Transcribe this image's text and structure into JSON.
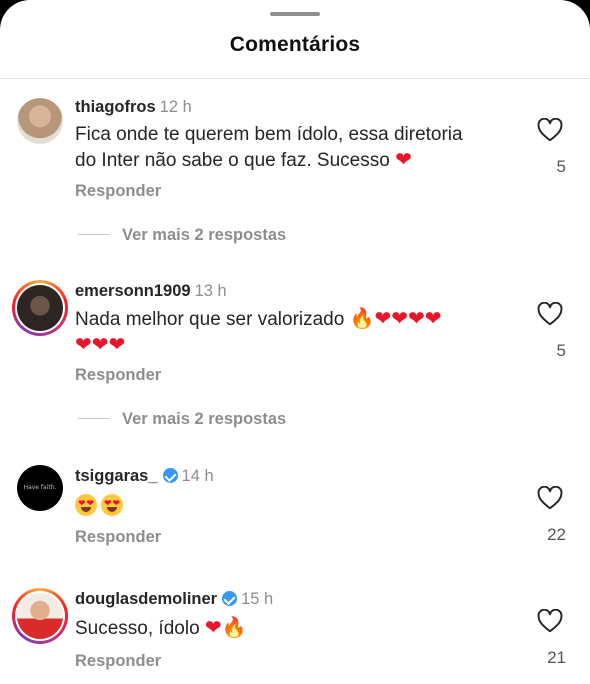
{
  "sheet": {
    "title": "Comentários"
  },
  "comments": [
    {
      "username": "thiagofros",
      "time": "12 h",
      "verified": false,
      "text_line1": "Fica onde te querem bem ídolo, essa diretoria",
      "text_line2": "do Inter não sabe o que faz. Sucesso ",
      "emojis_line2": [
        "heart"
      ],
      "reply_label": "Responder",
      "likes": "5",
      "view_more": "Ver mais 2 respostas"
    },
    {
      "username": "emersonn1909",
      "time": "13 h",
      "verified": false,
      "text_line1": "Nada melhor que ser valorizado ",
      "emojis_line1": [
        "fire",
        "heart",
        "heart",
        "heart",
        "heart"
      ],
      "emojis_line2": [
        "heart",
        "heart",
        "heart"
      ],
      "reply_label": "Responder",
      "likes": "5",
      "view_more": "Ver mais 2 respostas"
    },
    {
      "username": "tsiggaras_",
      "time": "14 h",
      "verified": true,
      "emojis_line1": [
        "heart-eyes",
        "heart-eyes"
      ],
      "avatar_text": "Have faith.",
      "reply_label": "Responder",
      "likes": "22"
    },
    {
      "username": "douglasdemoliner",
      "time": "15 h",
      "verified": true,
      "text_line1": "Sucesso, ídolo ",
      "emojis_line1": [
        "heart",
        "fire"
      ],
      "reply_label": "Responder",
      "likes": "21"
    }
  ],
  "icons": {
    "like": "heart-outline-icon",
    "verified": "verified-badge-icon"
  },
  "colors": {
    "heart": "#e8162b",
    "verified": "#3897f0",
    "muted": "#8e8e8e"
  }
}
